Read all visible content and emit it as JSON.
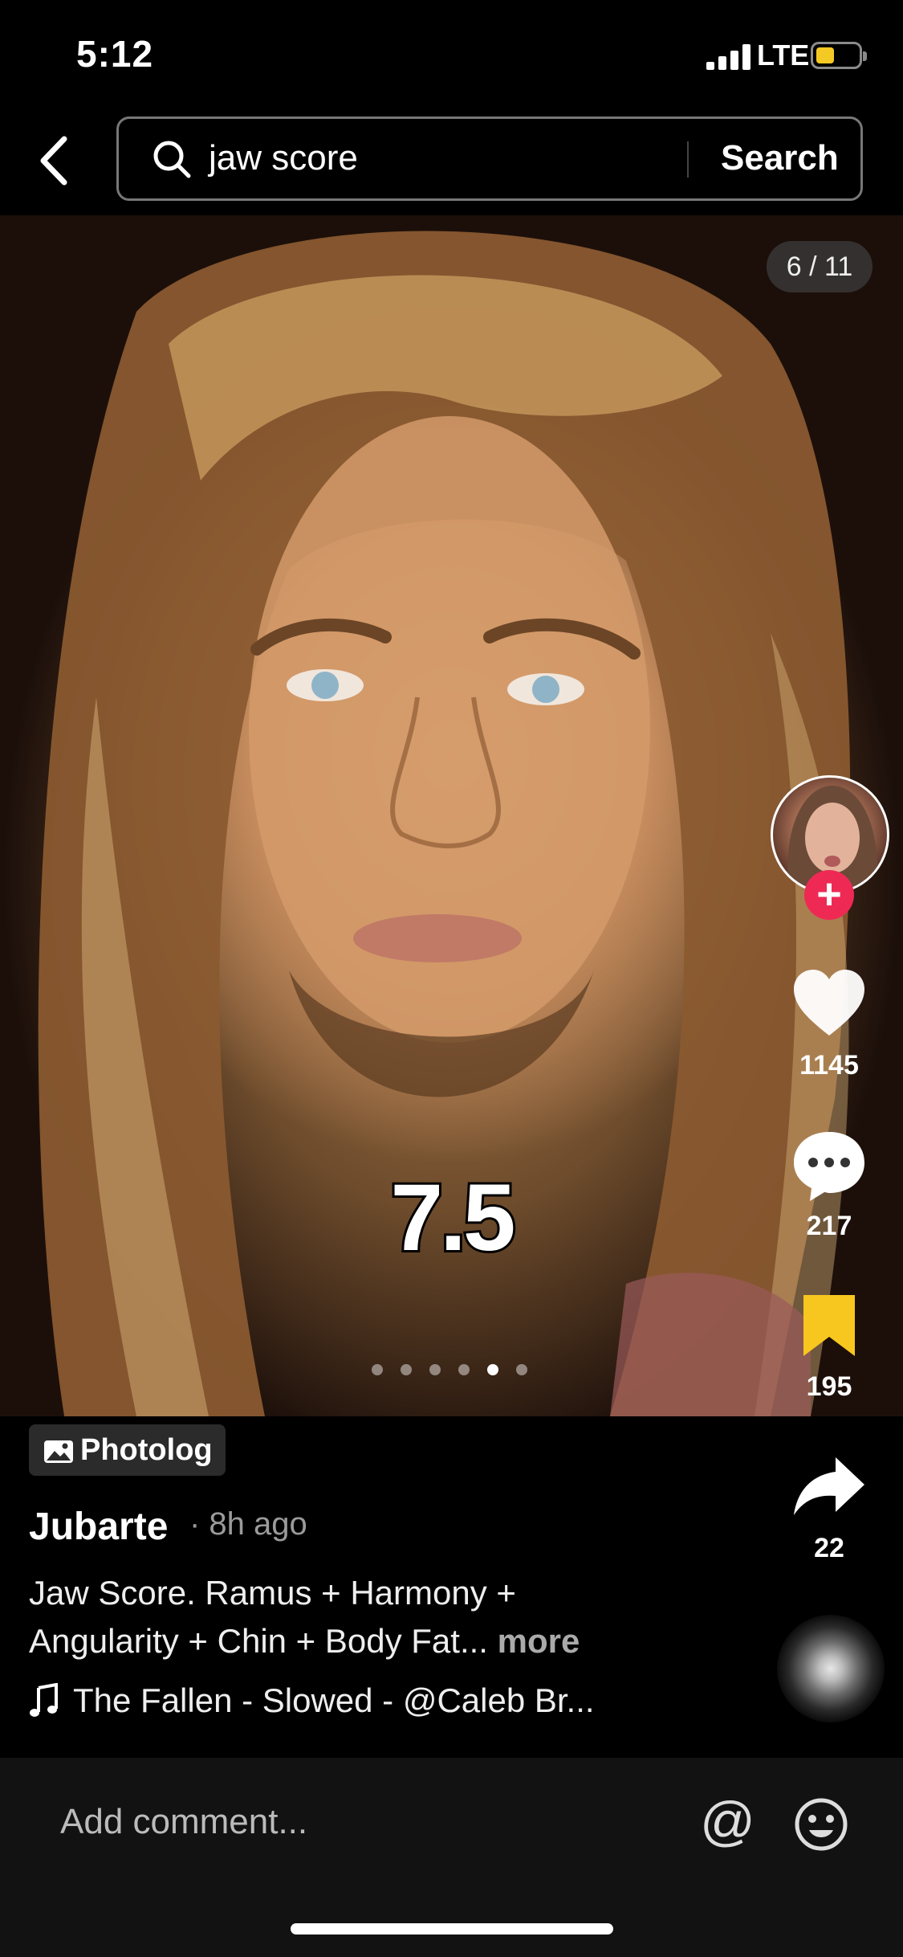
{
  "status_bar": {
    "time": "5:12",
    "network": "LTE",
    "battery_color": "#f5c924"
  },
  "search": {
    "query": "jaw score",
    "button_label": "Search"
  },
  "post": {
    "image_counter": "6 / 11",
    "score_overlay": "7.5",
    "carousel": {
      "dot_count": 6,
      "active_index": 4
    },
    "badge_label": "Photolog",
    "username": "Jubarte",
    "time_ago": "· 8h ago",
    "caption": "Jaw Score. Ramus + Harmony + Angularity + Chin + Body Fat...",
    "caption_more": "more",
    "music": "The Fallen - Slowed - @Caleb Br..."
  },
  "actions": {
    "likes": "1145",
    "comments": "217",
    "saves": "195",
    "shares": "22",
    "like_color": "#ffffff",
    "save_color": "#f7c71f",
    "follow_color": "#ee2a54"
  },
  "comment_bar": {
    "placeholder": "Add comment..."
  },
  "icons": [
    "back-icon",
    "search-icon",
    "heart-icon",
    "comment-icon",
    "bookmark-icon",
    "share-icon",
    "music-note-icon",
    "at-icon",
    "emoji-icon",
    "photo-icon"
  ]
}
